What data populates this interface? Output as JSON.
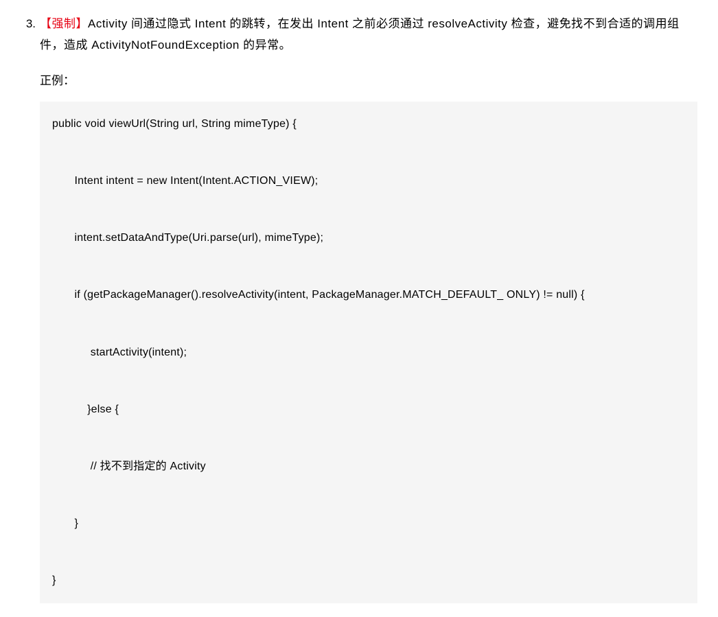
{
  "rule": {
    "number": "3.",
    "tag": "【强制】",
    "text_part1": "Activity 间通过隐式 Intent 的跳转，在发出 Intent 之前必须通过 resolveActivity 检查，避免找不到合适的调用组件，造成 ActivityNotFoundException 的异常。"
  },
  "example": {
    "label": "正例：",
    "code": "public void viewUrl(String url, String mimeType) {\n\n       Intent intent = new Intent(Intent.ACTION_VIEW);\n\n       intent.setDataAndType(Uri.parse(url), mimeType);\n\n       if (getPackageManager().resolveActivity(intent, PackageManager.MATCH_DEFAULT_ ONLY) != null) {\n\n            startActivity(intent);\n\n           }else {\n\n            // 找不到指定的 Activity\n\n       }\n\n}"
  }
}
